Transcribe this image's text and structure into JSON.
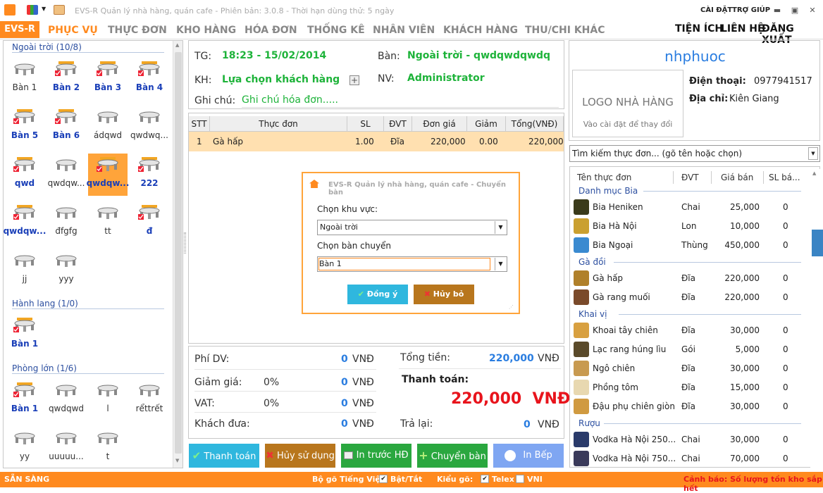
{
  "app": {
    "title": "EVS-R Quản lý nhà hàng, quán cafe - Phiên bản: 3.0.8 - Thời hạn dùng thử: 5 ngày",
    "settings": "CÀI ĐẶT",
    "help": "TRỢ GIÚP"
  },
  "menu": {
    "brand": "EVS-R",
    "items": [
      "PHỤC VỤ",
      "THỰC ĐƠN",
      "KHO HÀNG",
      "HÓA ĐƠN",
      "THỐNG KÊ",
      "NHÂN VIÊN",
      "KHÁCH HÀNG",
      "THU/CHI KHÁC"
    ],
    "right": [
      "TIỆN ÍCH",
      "LIÊN HỆ",
      "ĐĂNG XUẤT"
    ]
  },
  "zones": [
    {
      "title": "Ngoài trời (10/8)",
      "tables": [
        {
          "name": "Bàn 1",
          "occupied": false
        },
        {
          "name": "Bàn 2",
          "occupied": true
        },
        {
          "name": "Bàn 3",
          "occupied": true
        },
        {
          "name": "Bàn 4",
          "occupied": true
        },
        {
          "name": "Bàn 5",
          "occupied": true
        },
        {
          "name": "Bàn 6",
          "occupied": true
        },
        {
          "name": "ádqwd",
          "occupied": false
        },
        {
          "name": "qwdwq...",
          "occupied": false
        },
        {
          "name": "qwd",
          "occupied": true
        },
        {
          "name": "qwdqw...",
          "occupied": false
        },
        {
          "name": "qwdqw...",
          "occupied": true,
          "selected": true
        },
        {
          "name": "222",
          "occupied": true
        },
        {
          "name": "qwdqw...",
          "occupied": true
        },
        {
          "name": "đfgfg",
          "occupied": false
        },
        {
          "name": "tt",
          "occupied": false
        },
        {
          "name": "đ",
          "occupied": true
        },
        {
          "name": "jj",
          "occupied": false
        },
        {
          "name": "yyy",
          "occupied": false
        }
      ]
    },
    {
      "title": "Hành lang (1/0)",
      "tables": [
        {
          "name": "Bàn 1",
          "occupied": true
        }
      ]
    },
    {
      "title": "Phòng lớn (1/6)",
      "tables": [
        {
          "name": "Bàn 1",
          "occupied": true
        },
        {
          "name": "qwdqwd",
          "occupied": false
        },
        {
          "name": "l",
          "occupied": false
        },
        {
          "name": "rểttrết",
          "occupied": false
        },
        {
          "name": "yy",
          "occupied": false
        },
        {
          "name": "uuuuu...",
          "occupied": false
        },
        {
          "name": "t",
          "occupied": false
        }
      ]
    }
  ],
  "info": {
    "time_label": "TG:",
    "time_value": "18:23 - 15/02/2014",
    "table_label": "Bàn:",
    "table_value": "Ngoài trời - qwdqwdqwdq",
    "customer_label": "KH:",
    "customer_value": "Lựa chọn khách hàng",
    "staff_label": "NV:",
    "staff_value": "Administrator",
    "note_label": "Ghi chú:",
    "note_placeholder": "Ghi chú hóa đơn....."
  },
  "order": {
    "columns": [
      "STT",
      "Thực đơn",
      "SL",
      "ĐVT",
      "Đơn giá",
      "Giảm",
      "Tổng(VNĐ)"
    ],
    "rows": [
      {
        "stt": "1",
        "item": "Gà hấp",
        "qty": "1.00",
        "unit": "Đĩa",
        "price": "220,000",
        "discount": "0.00",
        "total": "220,000"
      }
    ]
  },
  "dialog": {
    "title": "EVS-R Quản lý nhà hàng, quán cafe - Chuyển bàn",
    "area_label": "Chọn khu vực:",
    "area_value": "Ngoài trời",
    "table_label": "Chọn bàn chuyển",
    "table_value": "Bàn 1",
    "ok": "Đồng ý",
    "cancel": "Hủy bỏ"
  },
  "totals": {
    "service_label": "Phí DV:",
    "service_value": "0",
    "discount_label": "Giảm giá:",
    "discount_pct": "0%",
    "discount_value": "0",
    "vat_label": "VAT:",
    "vat_pct": "0%",
    "vat_value": "0",
    "paid_label": "Khách đưa:",
    "paid_value": "0",
    "total_label": "Tổng tiền:",
    "total_value": "220,000",
    "pay_label": "Thanh toán:",
    "pay_value": "220,000  VNĐ",
    "change_label": "Trả lại:",
    "change_value": "0",
    "currency": "VNĐ"
  },
  "actions": [
    "Thanh toán",
    "Hủy sử dụng",
    "In trước HĐ",
    "Chuyển bàn",
    "In Bếp"
  ],
  "restaurant": {
    "name": "nhphuoc",
    "logo_text": "LOGO NHÀ HÀNG",
    "logo_hint": "Vào cài đặt để thay đổi",
    "phone_label": "Điện thoại:",
    "phone": "0977941517",
    "address_label": "Địa chỉ:",
    "address": "Kiên Giang"
  },
  "search": {
    "placeholder": "Tìm kiếm thực đơn... (gõ tên hoặc chọn)"
  },
  "menulist": {
    "columns": [
      "Tên thực đơn",
      "ĐVT",
      "Giá bán",
      "SL bá..."
    ],
    "categories": [
      {
        "name": "Danh mục Bia",
        "items": [
          {
            "name": "Bia Heniken",
            "unit": "Chai",
            "price": "25,000",
            "sold": "0"
          },
          {
            "name": "Bia Hà Nội",
            "unit": "Lon",
            "price": "10,000",
            "sold": "0"
          },
          {
            "name": "Bia Ngoại",
            "unit": "Thùng",
            "price": "450,000",
            "sold": "0"
          }
        ]
      },
      {
        "name": "Gà đồi",
        "items": [
          {
            "name": "Gà hấp",
            "unit": "Đĩa",
            "price": "220,000",
            "sold": "0"
          },
          {
            "name": "Gà rang muối",
            "unit": "Đĩa",
            "price": "220,000",
            "sold": "0"
          }
        ]
      },
      {
        "name": "Khai vị",
        "items": [
          {
            "name": "Khoai tây chiên",
            "unit": "Đĩa",
            "price": "30,000",
            "sold": "0"
          },
          {
            "name": "Lạc rang húng lìu",
            "unit": "Gói",
            "price": "5,000",
            "sold": "0"
          },
          {
            "name": "Ngô chiên",
            "unit": "Đĩa",
            "price": "30,000",
            "sold": "0"
          },
          {
            "name": "Phồng tôm",
            "unit": "Đĩa",
            "price": "15,000",
            "sold": "0"
          },
          {
            "name": "Đậu phụ chiên giòn",
            "unit": "Đĩa",
            "price": "30,000",
            "sold": "0"
          }
        ]
      },
      {
        "name": "Rượu",
        "items": [
          {
            "name": "Vodka Hà Nội 250...",
            "unit": "Chai",
            "price": "30,000",
            "sold": "0"
          },
          {
            "name": "Vodka Hà Nội 750...",
            "unit": "Chai",
            "price": "70,000",
            "sold": "0"
          }
        ]
      }
    ]
  },
  "statusbar": {
    "ready": "SẴN SÀNG",
    "vn_input": "Bộ gõ Tiếng Việt",
    "toggle": "Bật/Tắt",
    "mode": "Kiểu gõ:",
    "telex": "Telex",
    "vni": "VNI",
    "warning": "Cảnh báo: Số lượng tồn kho sắp hết"
  },
  "colors": {
    "accent": "#ff8a1f",
    "green": "#1eb33a",
    "blue": "#2a7de0",
    "red": "#e8141c",
    "zone_title": "#2c4fa0"
  }
}
